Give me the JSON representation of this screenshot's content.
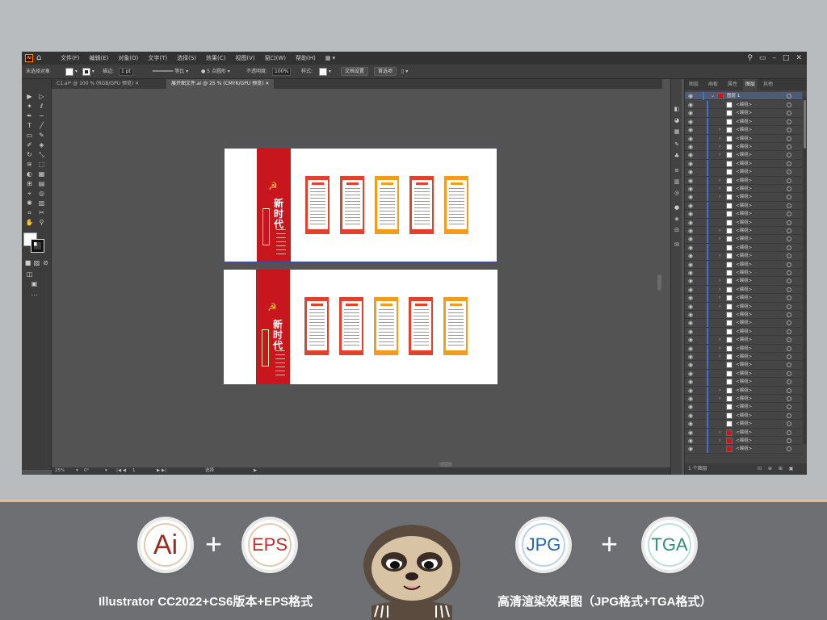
{
  "menubar": {
    "items": [
      "文件(F)",
      "编辑(E)",
      "对象(O)",
      "文字(T)",
      "选择(S)",
      "效果(C)",
      "视图(V)",
      "窗口(W)",
      "帮助(H)"
    ]
  },
  "controlbar": {
    "selection": "未选择对象",
    "stroke_label": "描边:",
    "stroke_value": "1 pt",
    "stroke_profile": "等比",
    "brush": "5 点圆形",
    "opacity_label": "不透明度:",
    "opacity_value": "100%",
    "style_label": "样式:",
    "doc_setup": "文档设置",
    "prefs": "首选项"
  },
  "tabs": [
    "C1.ai* @ 100 % (RGB/GPU 预览)",
    "展开图文件.ai @ 25 % (CMYK/GPU 预览)"
  ],
  "layers_panel": {
    "tabs": [
      "图层",
      "画板",
      "属性",
      "图层",
      "其他"
    ],
    "top_layer": "图层 1",
    "rows": [
      "<编组>",
      "<编组>",
      "<编组>",
      "<编组>",
      "<编组>",
      "<编组>",
      "<编组>",
      "<编组>",
      "<编组>",
      "<编组>",
      "<编组>",
      "<编组>",
      "<编组>",
      "<编组>",
      "<编组>",
      "<编组>",
      "<编组>",
      "<编组>",
      "<编组>",
      "<编组>",
      "<编组>",
      "<编组>",
      "<编组>",
      "<编组>",
      "<编组>",
      "<编组>",
      "<编组>",
      "<编组>",
      "<编组>",
      "<编组>",
      "<编组>",
      "<编组>",
      "<编组>",
      "<编组>",
      "<编组>",
      "<编组>",
      "<编组>",
      "<编组>",
      "<编组>",
      "<编组>",
      "<编组>",
      "<编组>"
    ],
    "footer": "1 个图层"
  },
  "statusbar": {
    "zoom": "25%",
    "angle": "0°",
    "page": "1",
    "mode": "选择"
  },
  "artboard": {
    "title": "新时代"
  },
  "promo": {
    "badge_ai": "Ai",
    "badge_eps": "EPS",
    "badge_jpg": "JPG",
    "badge_tga": "TGA",
    "plus": "+",
    "caption_left": "Illustrator CC2022+CS6版本+EPS格式",
    "caption_right": "高清渲染效果图（JPG格式+TGA格式）"
  },
  "colors": {
    "party_red": "#c8161e",
    "panel_orange": "#f29b1d",
    "panel_red": "#e2422b"
  }
}
